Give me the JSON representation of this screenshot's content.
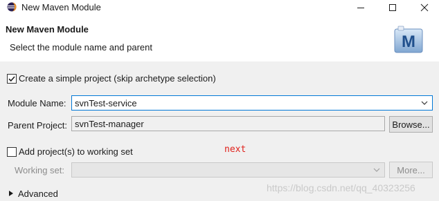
{
  "window": {
    "title": "New Maven Module",
    "icon": "eclipse-icon",
    "controls": [
      "minimize-icon",
      "maximize-icon",
      "close-icon"
    ]
  },
  "header": {
    "title": "New Maven Module",
    "description": "Select the module name and parent",
    "logo_icon": "maven-m-icon",
    "logo_text": "M"
  },
  "form": {
    "simple_project": {
      "checked": true,
      "label": "Create a simple project (skip archetype selection)"
    },
    "module_name": {
      "label": "Module Name:",
      "value": "svnTest-service"
    },
    "parent_project": {
      "label": "Parent Project:",
      "value": "svnTest-manager",
      "browse_label": "Browse..."
    },
    "working_set_checkbox": {
      "checked": false,
      "label": "Add project(s) to working set"
    },
    "working_set": {
      "label": "Working set:",
      "value": "",
      "more_label": "More..."
    },
    "advanced": {
      "label": "Advanced",
      "expanded": false
    }
  },
  "annotation": {
    "text": "next",
    "color": "#e0201a"
  },
  "watermark": {
    "text": "https://blog.csdn.net/qq_40323256"
  },
  "colors": {
    "focus_border": "#0078d7",
    "form_background": "#f0f0f0"
  }
}
